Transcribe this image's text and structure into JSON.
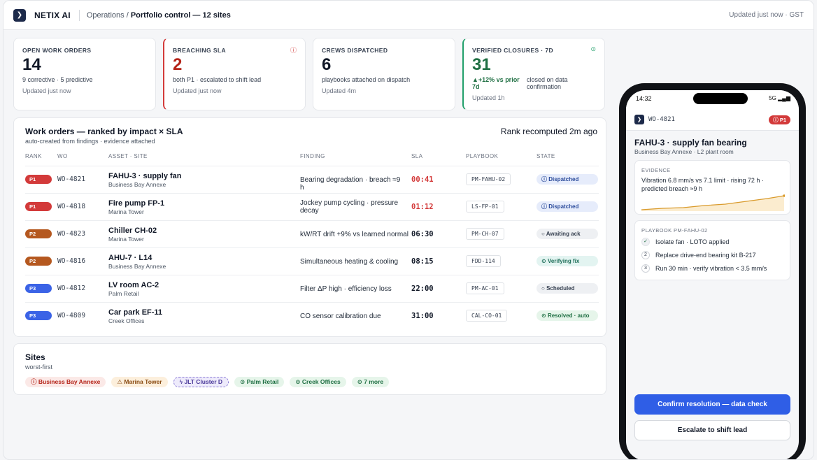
{
  "header": {
    "brand": "NETIX AI",
    "breadcrumb_prefix": "Operations / ",
    "breadcrumb_current": "Portfolio control — 12 sites",
    "updated": "Updated just now · GST"
  },
  "kpis": [
    {
      "title": "OPEN WORK ORDERS",
      "value": "14",
      "sub": "9 corrective · 5 predictive",
      "updated": "Updated just now"
    },
    {
      "title": "BREACHING SLA",
      "value": "2",
      "sub": "both P1 · escalated to shift lead",
      "updated": "Updated just now",
      "icon": "alert-icon"
    },
    {
      "title": "CREWS DISPATCHED",
      "value": "6",
      "sub": "playbooks attached on dispatch",
      "updated": "Updated 4m"
    },
    {
      "title": "VERIFIED CLOSURES · 7D",
      "value": "31",
      "trend": "▲+12% vs prior 7d",
      "note": "closed on data confirmation",
      "updated": "Updated 1h",
      "icon": "check-circle-icon"
    }
  ],
  "work_orders": {
    "title": "Work orders — ranked by impact × SLA",
    "subtitle": "auto-created from findings · evidence attached",
    "rank_note": "Rank recomputed 2m ago",
    "columns": [
      "RANK",
      "WO",
      "ASSET · SITE",
      "FINDING",
      "SLA",
      "PLAYBOOK",
      "STATE"
    ],
    "rows": [
      {
        "rank": "P1",
        "wo": "WO-4821",
        "asset": "FAHU-3 · supply fan",
        "site": "Business Bay Annexe",
        "finding": "Bearing degradation · breach ≈9 h",
        "sla": "00:41",
        "playbook": "PM-FAHU-02",
        "state": "Dispatched"
      },
      {
        "rank": "P1",
        "wo": "WO-4818",
        "asset": "Fire pump FP-1",
        "site": "Marina Tower",
        "finding": "Jockey pump cycling · pressure decay",
        "sla": "01:12",
        "playbook": "LS-FP-01",
        "state": "Dispatched"
      },
      {
        "rank": "P2",
        "wo": "WO-4823",
        "asset": "Chiller CH-02",
        "site": "Marina Tower",
        "finding": "kW/RT drift +9% vs learned normal",
        "sla": "06:30",
        "playbook": "PM-CH-07",
        "state": "Awaiting ack"
      },
      {
        "rank": "P2",
        "wo": "WO-4816",
        "asset": "AHU-7 · L14",
        "site": "Business Bay Annexe",
        "finding": "Simultaneous heating & cooling",
        "sla": "08:15",
        "playbook": "FDD-114",
        "state": "Verifying fix"
      },
      {
        "rank": "P3",
        "wo": "WO-4812",
        "asset": "LV room AC-2",
        "site": "Palm Retail",
        "finding": "Filter ΔP high · efficiency loss",
        "sla": "22:00",
        "playbook": "PM-AC-01",
        "state": "Scheduled"
      },
      {
        "rank": "P3",
        "wo": "WO-4809",
        "asset": "Car park EF-11",
        "site": "Creek Offices",
        "finding": "CO sensor calibration due",
        "sla": "31:00",
        "playbook": "CAL-CO-01",
        "state": "Resolved · auto"
      }
    ]
  },
  "sites": {
    "title": "Sites",
    "subtitle": "worst-first",
    "chips": [
      {
        "icon": "ⓘ",
        "label": "Business Bay Annexe"
      },
      {
        "icon": "⚠",
        "label": "Marina Tower"
      },
      {
        "icon": "ϟ",
        "label": "JLT Cluster D"
      },
      {
        "icon": "⊙",
        "label": "Palm Retail"
      },
      {
        "icon": "⊙",
        "label": "Creek Offices"
      },
      {
        "icon": "⊙",
        "label": "7 more"
      }
    ]
  },
  "phone": {
    "time": "14:32",
    "signal": "5G ▂▄▆",
    "wo": "WO-4821",
    "priority": "ⓘ P1",
    "title": "FAHU-3 · supply fan bearing",
    "subtitle": "Business Bay Annexe · L2 plant room",
    "evidence_label": "EVIDENCE",
    "evidence_text": "Vibration 6.8 mm/s vs 7.1 limit · rising 72 h · predicted breach ≈9 h",
    "playbook_label": "PLAYBOOK PM-FAHU-02",
    "steps": [
      {
        "num": "✓",
        "text": "Isolate fan · LOTO applied"
      },
      {
        "num": "2",
        "text": "Replace drive-end bearing kit B-217"
      },
      {
        "num": "3",
        "text": "Run 30 min · verify vibration < 3.5 mm/s"
      }
    ],
    "confirm": "Confirm resolution — data check",
    "escalate": "Escalate to shift lead"
  },
  "colors": {
    "p1": "#d33a3a",
    "p2": "#b5581f",
    "p3": "#3b63e6",
    "accent": "#2f5ee6",
    "sla_red": "#d33a3a"
  }
}
